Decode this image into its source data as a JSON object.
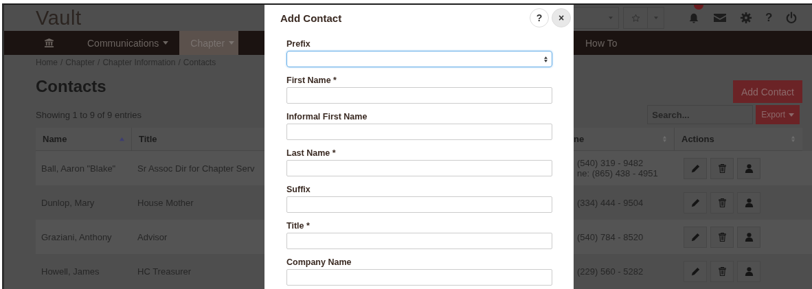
{
  "header": {
    "logo": "Vault",
    "help_glyph": "?"
  },
  "nav_left": [
    {
      "label": "Communications",
      "dropdown": true,
      "selected": false
    },
    {
      "label": "Chapter",
      "dropdown": true,
      "selected": true
    }
  ],
  "nav_right": [
    {
      "label": "How To",
      "dropdown": false,
      "selected": false
    }
  ],
  "breadcrumb": {
    "separator": "/",
    "items": [
      "Home",
      "Chapter",
      "Chapter Information",
      "Contacts"
    ]
  },
  "page_title": "Contacts",
  "entries_info": "Showing 1 to 9 of 9 entries",
  "add_button": "Add Contact",
  "search": {
    "placeholder": "Search..."
  },
  "export_button": "Export",
  "table": {
    "columns_left": [
      {
        "label": "Name",
        "sorted": true
      },
      {
        "label": "Title"
      }
    ],
    "columns_right": [
      {
        "label": "ne",
        "sorted": false
      },
      {
        "label": "Actions",
        "sorted": false
      }
    ],
    "rows": [
      {
        "name": "Ball, Aaron \"Blake\"",
        "title": "Sr Assoc Dir for Chapter Serv",
        "phone": [
          "(540) 319 - 9482",
          "ne: (865) 438 - 4951"
        ]
      },
      {
        "name": "Dunlop, Mary",
        "title": "House Mother",
        "phone": [
          "(334) 444 - 9504"
        ]
      },
      {
        "name": "Graziani, Anthony",
        "title": "Advisor",
        "phone": [
          "(540) 784 - 8520"
        ]
      },
      {
        "name": "Howell, James",
        "title": "HC Treasurer",
        "phone": [
          "(229) 560 - 5282"
        ]
      }
    ]
  },
  "modal": {
    "title": "Add Contact",
    "help": "?",
    "close": "×",
    "fields": [
      {
        "label": "First Name *",
        "kind": "text",
        "focused": false
      },
      {
        "label": "Informal First Name",
        "kind": "text",
        "focused": false
      },
      {
        "label": "Last Name *",
        "kind": "text",
        "focused": false
      },
      {
        "label": "Suffix",
        "kind": "text",
        "focused": false
      },
      {
        "label": "Title *",
        "kind": "text",
        "focused": false
      },
      {
        "label": "Company Name",
        "kind": "text",
        "focused": false
      }
    ],
    "prefix": {
      "label": "Prefix",
      "kind": "select",
      "focused": true
    }
  }
}
